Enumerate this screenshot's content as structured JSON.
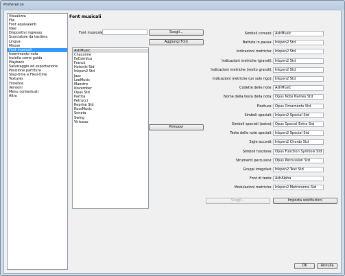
{
  "window": {
    "title": "Preferenze"
  },
  "sidebar": {
    "items": [
      {
        "label": "Visualizza"
      },
      {
        "label": "File"
      },
      {
        "label": "Font equivalenti"
      },
      {
        "label": "Idee"
      },
      {
        "label": "Dispositivi ingresso"
      },
      {
        "label": "Scorciatoie da tastiera"
      },
      {
        "label": "Lingua"
      },
      {
        "label": "Mouse"
      },
      {
        "label": "Font musicali"
      },
      {
        "label": "Inserimento nota"
      },
      {
        "label": "Inciolla come guida"
      },
      {
        "label": "Playback"
      },
      {
        "label": "Salvataggio ed esportazione"
      },
      {
        "label": "Posizione partitura"
      },
      {
        "label": "Step-time e Flexi-time"
      },
      {
        "label": "Textures"
      },
      {
        "label": "Timeline"
      },
      {
        "label": "Versioni"
      },
      {
        "label": "Menu contestuali"
      },
      {
        "label": "Altro"
      }
    ],
    "selected_index": 8
  },
  "panel": {
    "heading": "Font musicali",
    "font_musicale_label": "Font musicale:",
    "font_musicale_value": "",
    "scegli_button": "Scegli...",
    "aggiungi_button": "Aggiungi Font",
    "rimuovi_button": "Rimuovi",
    "font_list": [
      "AshMusic",
      "Chaconne",
      "FaCsimilus",
      "Franck",
      "Helsinki Std",
      "Inkpen2 Std",
      "Jazz",
      "LeeMusic",
      "Maestro",
      "November",
      "Opus Std",
      "Partita",
      "Petrucci",
      "Reprise Std",
      "RussMusic",
      "Sonata",
      "Swing",
      "Virtuoso"
    ],
    "font_list_selected": 0,
    "symbols": [
      {
        "label": "Simboli comuni:",
        "value": "AshMusic"
      },
      {
        "label": "Battute in pausa:",
        "value": "Inkpen2 Std"
      },
      {
        "label": "Indicazioni metriche:",
        "value": "Inkpen2 Std"
      },
      {
        "label": "Indicazioni metriche (grandi):",
        "value": "Inkpen2 Std"
      },
      {
        "label": "Indicazioni metriche (molto grandi):",
        "value": "Inkpen2 Std"
      },
      {
        "label": "Indicazioni metriche (un solo rigo):",
        "value": "Inkpen2 Std"
      },
      {
        "label": "Codette delle note:",
        "value": "AshMusic"
      },
      {
        "label": "Nome della testa della nota:",
        "value": "Opus Note Names Std"
      },
      {
        "label": "Fioriture:",
        "value": "Opus Ornaments Std"
      },
      {
        "label": "Simboli speciali:",
        "value": "Inkpen2 Special Std"
      },
      {
        "label": "Simboli speciali (extra):",
        "value": "Opus Special Extra Std"
      },
      {
        "label": "Teste delle note speciali:",
        "value": "Inkpen2 Special Std"
      },
      {
        "label": "Sigle accordi:",
        "value": "Inkpen2 Chords Std"
      },
      {
        "label": "Simboli funzione:",
        "value": "Opus Function Symbols Std"
      },
      {
        "label": "Strumenti percussivi:",
        "value": "Opus Percussion Std"
      },
      {
        "label": "Gruppi irregolari:",
        "value": "Inkpen2 Text Std"
      },
      {
        "label": "Font di testo:",
        "value": "AshAlpha"
      },
      {
        "label": "Modulazioni metriche:",
        "value": "Inkpen2 Metronome Std"
      }
    ],
    "scegli_bottom_button": "Scegli...",
    "imposta_button": "Imposta sostituzioni"
  },
  "footer": {
    "ok_button": "OK",
    "annulla_button": "Annulla"
  }
}
